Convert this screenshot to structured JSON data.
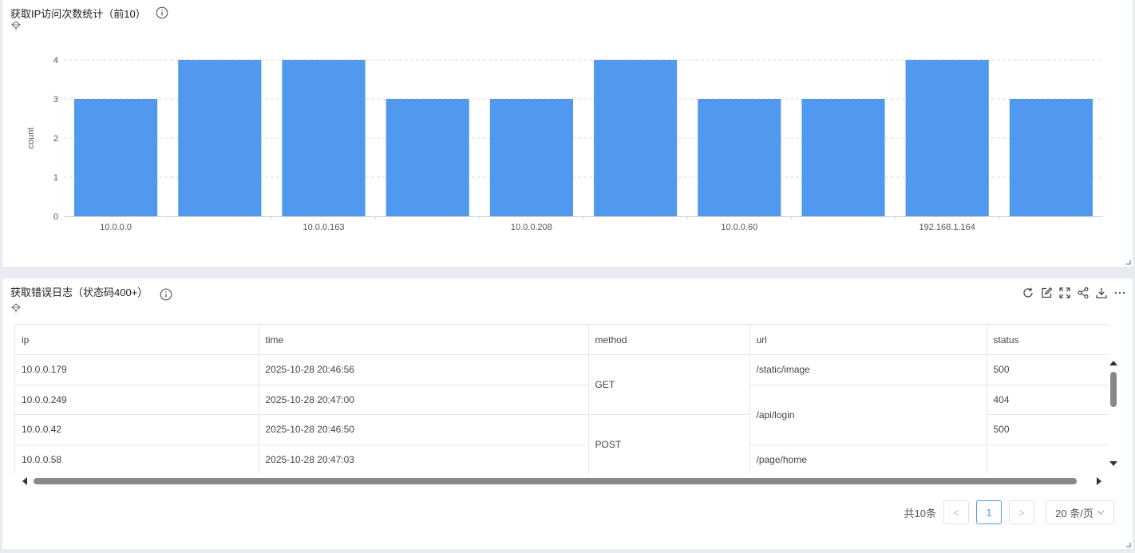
{
  "chart_panel": {
    "title": "获取IP访问次数统计（前10）"
  },
  "chart_data": {
    "type": "bar",
    "title": "获取IP访问次数统计（前10）",
    "ylabel": "count",
    "ylim": [
      0,
      4
    ],
    "yticks": [
      0,
      1,
      2,
      3,
      4
    ],
    "grid": true,
    "color": "#5199ef",
    "categories": [
      "10.0.0.0",
      "",
      "10.0.0.163",
      "",
      "10.0.0.208",
      "",
      "10.0.0.60",
      "",
      "192.168.1.164",
      ""
    ],
    "values": [
      3,
      4,
      4,
      3,
      3,
      4,
      3,
      3,
      4,
      3
    ]
  },
  "table_panel": {
    "title": "获取错误日志（状态码400+）",
    "toolbar": [
      "refresh-icon",
      "edit-icon",
      "fullscreen-icon",
      "share-icon",
      "download-icon",
      "more-icon"
    ]
  },
  "table": {
    "columns": [
      "ip",
      "time",
      "method",
      "url",
      "status"
    ],
    "rows": [
      {
        "ip": "10.0.0.179",
        "time": "2025-10-28 20:46:56",
        "status": "500"
      },
      {
        "ip": "10.0.0.249",
        "time": "2025-10-28 20:47:00",
        "status": "404"
      },
      {
        "ip": "10.0.0.42",
        "time": "2025-10-28 20:46:50",
        "status": "500"
      },
      {
        "ip": "10.0.0.58",
        "time": "2025-10-28 20:47:03",
        "status": ""
      }
    ],
    "method_groups": [
      "GET",
      "POST"
    ],
    "url_groups": [
      "/static/image",
      "/api/login",
      "/page/home"
    ]
  },
  "pagination": {
    "total": "共10条",
    "prev": "<",
    "page": "1",
    "next": ">",
    "page_size": "20 条/页"
  }
}
